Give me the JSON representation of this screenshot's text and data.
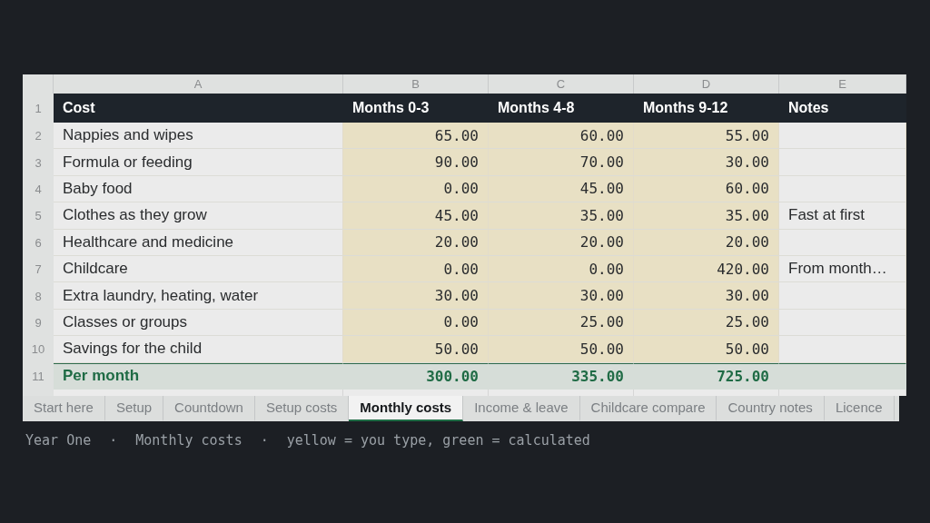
{
  "columns": [
    "A",
    "B",
    "C",
    "D",
    "E"
  ],
  "header": {
    "row_number": "1",
    "cells": [
      "Cost",
      "Months 0-3",
      "Months 4-8",
      "Months 9-12",
      "Notes"
    ]
  },
  "rows": [
    {
      "kind": "input",
      "row_number": "2",
      "label": "Nappies and wipes",
      "values": [
        "65.00",
        "60.00",
        "55.00"
      ]
    },
    {
      "kind": "input",
      "row_number": "3",
      "label": "Formula or feeding",
      "values": [
        "90.00",
        "70.00",
        "30.00"
      ]
    },
    {
      "kind": "input",
      "row_number": "4",
      "label": "Baby food",
      "values": [
        "0.00",
        "45.00",
        "60.00"
      ]
    },
    {
      "kind": "input",
      "row_number": "5",
      "label": "Clothes as they grow",
      "values": [
        "45.00",
        "35.00",
        "35.00"
      ],
      "note": "Fast at first"
    },
    {
      "kind": "input",
      "row_number": "6",
      "label": "Healthcare and medicine",
      "values": [
        "20.00",
        "20.00",
        "20.00"
      ]
    },
    {
      "kind": "input",
      "row_number": "7",
      "label": "Childcare",
      "values": [
        "0.00",
        "0.00",
        "420.00"
      ],
      "note": "From  month…"
    },
    {
      "kind": "input",
      "row_number": "8",
      "label": "Extra laundry, heating, water",
      "values": [
        "30.00",
        "30.00",
        "30.00"
      ]
    },
    {
      "kind": "input",
      "row_number": "9",
      "label": "Classes or groups",
      "values": [
        "0.00",
        "25.00",
        "25.00"
      ]
    },
    {
      "kind": "input",
      "row_number": "10",
      "label": "Savings for the child",
      "values": [
        "50.00",
        "50.00",
        "50.00"
      ]
    },
    {
      "kind": "total",
      "row_number": "11",
      "label": "Per month",
      "values": [
        "300.00",
        "335.00",
        "725.00"
      ]
    }
  ],
  "sheet_tabs": [
    {
      "label": "Start here",
      "selected": false
    },
    {
      "label": "Setup",
      "selected": false
    },
    {
      "label": "Countdown",
      "selected": false
    },
    {
      "label": "Setup costs",
      "selected": false
    },
    {
      "label": "Monthly costs",
      "selected": true
    },
    {
      "label": "Income & leave",
      "selected": false
    },
    {
      "label": "Childcare compare",
      "selected": false
    },
    {
      "label": "Country notes",
      "selected": false
    },
    {
      "label": "Licence",
      "selected": false
    }
  ],
  "caption": [
    "Year One",
    "·",
    "Monthly costs",
    "·",
    "yellow = you type, green = calculated"
  ]
}
